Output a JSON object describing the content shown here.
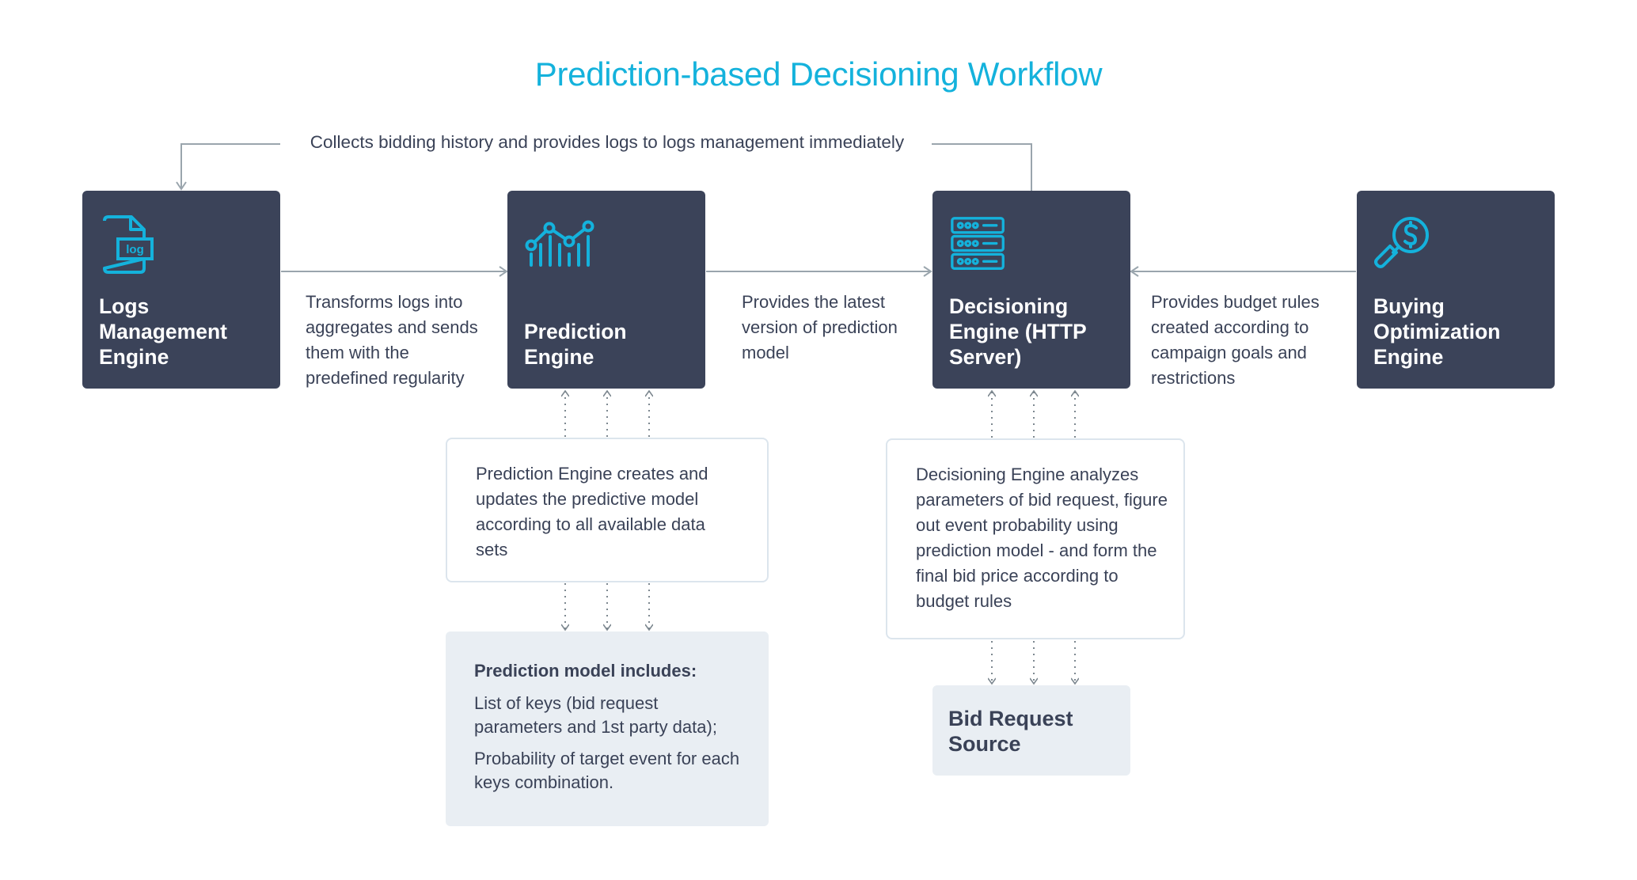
{
  "title": "Prediction-based Decisioning Workflow",
  "feedback_label": "Collects bidding history and provides logs to logs management immediately",
  "colors": {
    "accent": "#14b2dc",
    "engine_bg": "#3b4359",
    "text": "#3a4257",
    "connector": "#9aa5ad",
    "info_bg": "#e9eef3",
    "desc_border": "#dce5ed"
  },
  "engines": [
    {
      "id": "logs",
      "icon": "log-file-icon",
      "name": "Logs Management Engine"
    },
    {
      "id": "prediction",
      "icon": "chart-analytics-icon",
      "name": "Prediction Engine"
    },
    {
      "id": "decisioning",
      "icon": "server-icon",
      "name": "Decisioning Engine (HTTP Server)"
    },
    {
      "id": "buying",
      "icon": "money-search-icon",
      "name": "Buying Optimization Engine"
    }
  ],
  "flows": {
    "logs_to_prediction": "Transforms logs into aggregates and sends them with the predefined regularity",
    "prediction_to_decisioning": "Provides the latest version of prediction model",
    "buying_to_decisioning": "Provides budget rules created according to campaign goals and restrictions"
  },
  "descriptions": {
    "prediction": "Prediction Engine creates and updates the predictive model according to all available data sets",
    "decisioning": "Decisioning Engine analyzes parameters of bid request, figure out event probability using prediction model - and form the final bid price according to budget rules"
  },
  "prediction_model": {
    "heading": "Prediction model includes:",
    "items": [
      "List of keys (bid request parameters and 1st party data);",
      "Probability of target event for each keys combination."
    ]
  },
  "bid_request_source": {
    "heading": "Bid Request Source"
  }
}
